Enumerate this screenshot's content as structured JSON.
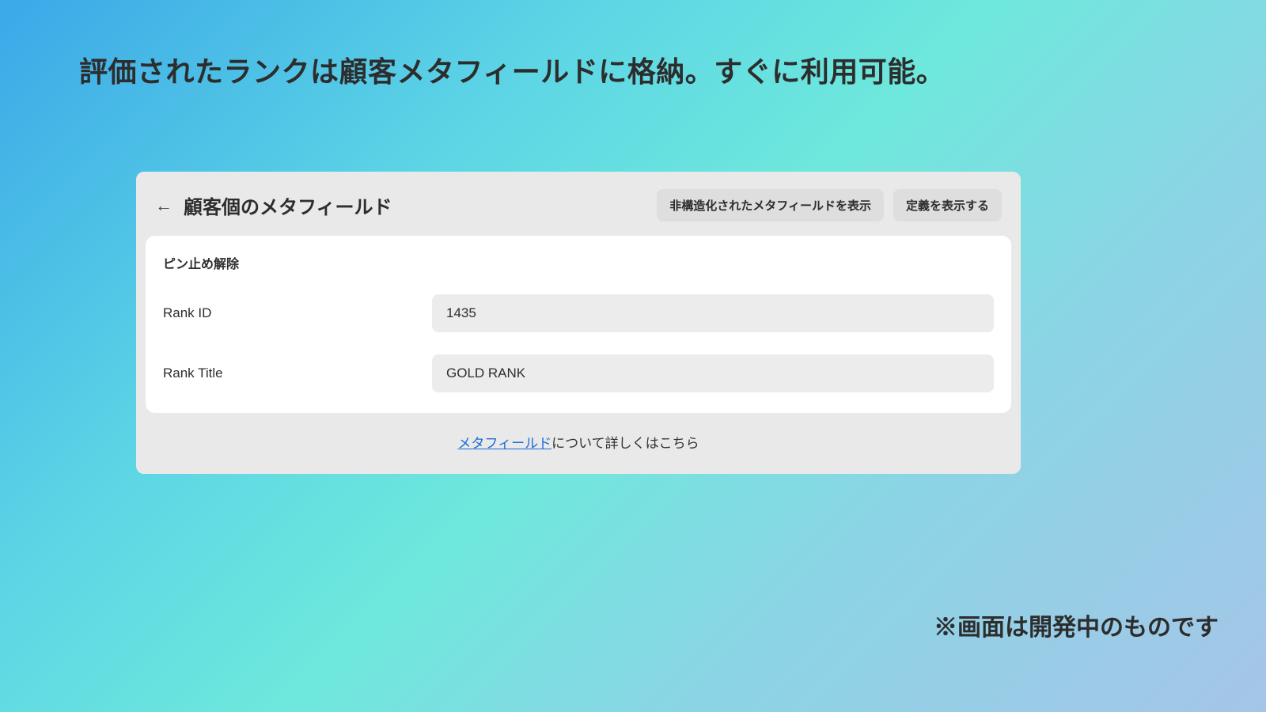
{
  "headline": "評価されたランクは顧客メタフィールドに格納。すぐに利用可能。",
  "panel": {
    "title": "顧客個のメタフィールド",
    "buttons": {
      "unstructured": "非構造化されたメタフィールドを表示",
      "definitions": "定義を表示する"
    }
  },
  "card": {
    "section_label": "ピン止め解除",
    "fields": [
      {
        "label": "Rank ID",
        "value": "1435"
      },
      {
        "label": "Rank Title",
        "value": "GOLD RANK"
      }
    ]
  },
  "footer": {
    "link_text": "メタフィールド",
    "suffix": "について詳しくはこちら"
  },
  "disclaimer": "※画面は開発中のものです"
}
